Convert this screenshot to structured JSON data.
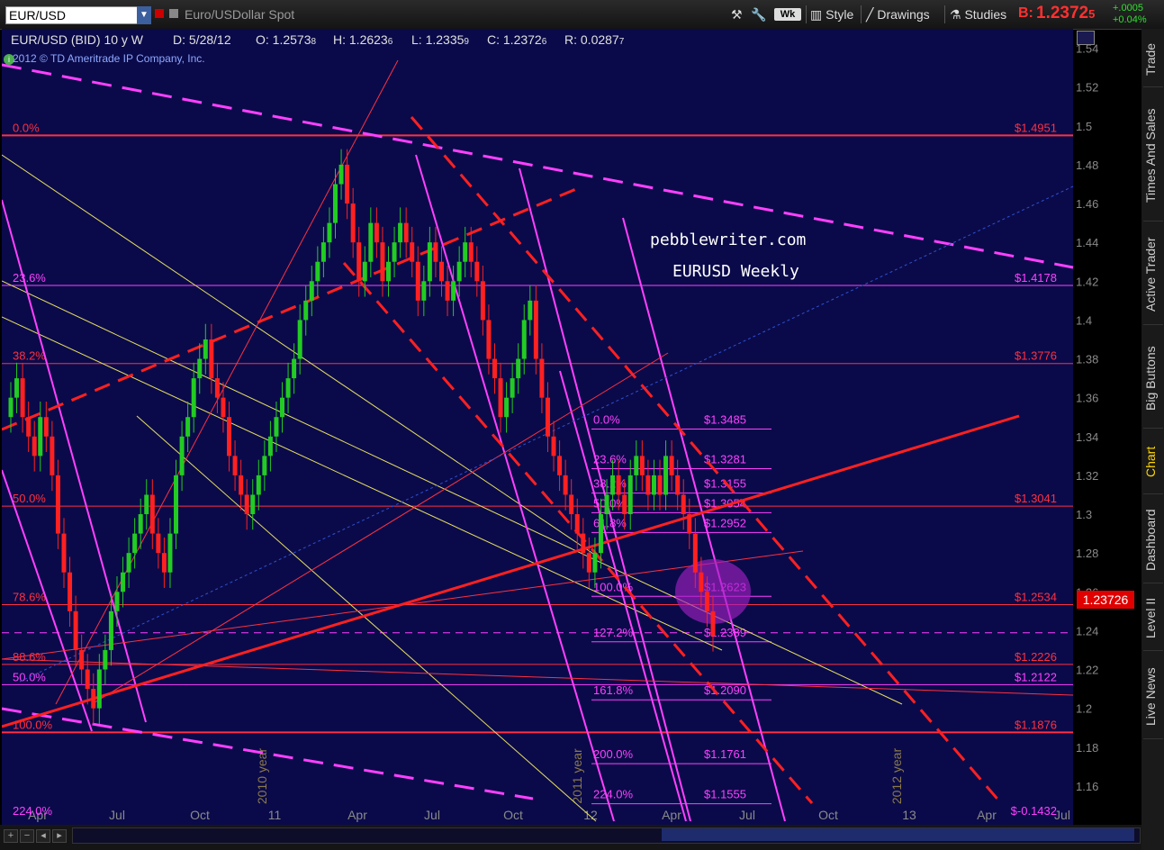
{
  "toolbar": {
    "symbol": "EUR/USD",
    "description": "Euro/USDollar Spot",
    "period_badge": "Wk",
    "style_label": "Style",
    "drawings_label": "Drawings",
    "studies_label": "Studies",
    "bid_prefix": "B:",
    "bid_value": "1.2372",
    "bid_superscript": "5",
    "change_abs": "+.0005",
    "change_pct": "+0.04%"
  },
  "header": {
    "title": "EUR/USD (BID) 10 y W",
    "date": "D: 5/28/12",
    "open": "O: 1.2573",
    "open_sub": "8",
    "high": "H: 1.2623",
    "high_sub": "6",
    "low": "L: 1.2335",
    "low_sub": "9",
    "close": "C: 1.2372",
    "close_sub": "6",
    "range": "R: 0.0287",
    "range_sub": "7",
    "copyright": "2012 © TD Ameritrade IP Company, Inc."
  },
  "watermark": {
    "site": "pebblewriter.com",
    "subtitle": "EURUSD Weekly"
  },
  "price_badge": "1.23726",
  "side_tabs": [
    "Trade",
    "Times And Sales",
    "Active Trader",
    "Big Buttons",
    "Chart",
    "Dashboard",
    "Level II",
    "Live News"
  ],
  "side_tab_active": "Chart",
  "colors": {
    "background": "#0a0a4a",
    "up_candle": "#22cc22",
    "down_candle": "#ff2020",
    "fib_line": "#ff3040",
    "fib_magenta": "#ff40ff",
    "trend_yellow": "#e8e060"
  },
  "chart_data": {
    "type": "candlestick",
    "yaxis": {
      "range": [
        1.14,
        1.55
      ],
      "ticks": [
        "1.54",
        "1.52",
        "1.5",
        "1.48",
        "1.46",
        "1.44",
        "1.42",
        "1.4",
        "1.38",
        "1.36",
        "1.34",
        "1.32",
        "1.3",
        "1.28",
        "1.26",
        "1.24",
        "1.22",
        "1.2",
        "1.18",
        "1.16"
      ]
    },
    "xaxis": {
      "ticks": [
        "Apr",
        "Jul",
        "Oct",
        "11",
        "Apr",
        "Jul",
        "Oct",
        "12",
        "Apr",
        "Jul",
        "Oct",
        "13",
        "Apr",
        "Jul"
      ],
      "year_markers": [
        "2010 year",
        "2011 year",
        "2012 year"
      ]
    },
    "closes": [
      1.36,
      1.37,
      1.35,
      1.34,
      1.33,
      1.35,
      1.34,
      1.32,
      1.29,
      1.27,
      1.25,
      1.23,
      1.22,
      1.21,
      1.2,
      1.22,
      1.23,
      1.25,
      1.26,
      1.27,
      1.28,
      1.29,
      1.3,
      1.31,
      1.29,
      1.28,
      1.27,
      1.29,
      1.32,
      1.34,
      1.35,
      1.37,
      1.38,
      1.39,
      1.37,
      1.36,
      1.35,
      1.33,
      1.32,
      1.31,
      1.3,
      1.31,
      1.32,
      1.33,
      1.34,
      1.35,
      1.36,
      1.37,
      1.38,
      1.4,
      1.41,
      1.42,
      1.43,
      1.44,
      1.45,
      1.47,
      1.48,
      1.46,
      1.44,
      1.42,
      1.43,
      1.45,
      1.44,
      1.42,
      1.43,
      1.44,
      1.45,
      1.44,
      1.43,
      1.41,
      1.42,
      1.44,
      1.43,
      1.42,
      1.41,
      1.42,
      1.43,
      1.44,
      1.43,
      1.42,
      1.4,
      1.38,
      1.37,
      1.35,
      1.36,
      1.37,
      1.38,
      1.4,
      1.41,
      1.38,
      1.36,
      1.34,
      1.33,
      1.32,
      1.31,
      1.3,
      1.29,
      1.28,
      1.27,
      1.28,
      1.3,
      1.31,
      1.32,
      1.31,
      1.3,
      1.32,
      1.33,
      1.32,
      1.31,
      1.32,
      1.31,
      1.33,
      1.32,
      1.31,
      1.3,
      1.29,
      1.27,
      1.26,
      1.25,
      1.2372
    ],
    "left_fib": [
      {
        "label": "0.0%",
        "price": "$1.4951",
        "level": 1.4951
      },
      {
        "label": "23.6%",
        "price": "$1.4178",
        "level": 1.4178
      },
      {
        "label": "38.2%",
        "price": "$1.3776",
        "level": 1.3776
      },
      {
        "label": "50.0%",
        "price": "$1.3041",
        "level": 1.3041
      },
      {
        "label": "78.6%",
        "price": "$1.2534",
        "level": 1.2534
      },
      {
        "label": "88.6%",
        "price": "$1.2226",
        "level": 1.2226
      },
      {
        "label": "50.0%",
        "price": "$1.2122",
        "level": 1.2122
      },
      {
        "label": "100.0%",
        "price": "$1.1876",
        "level": 1.1876
      },
      {
        "label": "224.0%",
        "price": "$-0.1432",
        "level": 1.1432
      }
    ],
    "right_fib": [
      {
        "label": "0.0%",
        "price": "$1.3485",
        "level": 1.3485
      },
      {
        "label": "23.6%",
        "price": "$1.3281",
        "level": 1.3281
      },
      {
        "label": "38.2%",
        "price": "$1.3155",
        "level": 1.3155
      },
      {
        "label": "50.0%",
        "price": "$1.3054",
        "level": 1.3054
      },
      {
        "label": "61.8%",
        "price": "$1.2952",
        "level": 1.2952
      },
      {
        "label": "100.0%",
        "price": "$1.2623",
        "level": 1.2623
      },
      {
        "label": "127.2%",
        "price": "$1.2389",
        "level": 1.2389
      },
      {
        "label": "161.8%",
        "price": "$1.2090",
        "level": 1.209
      },
      {
        "label": "200.0%",
        "price": "$1.1761",
        "level": 1.1761
      },
      {
        "label": "224.0%",
        "price": "$1.1555",
        "level": 1.1555
      }
    ]
  }
}
